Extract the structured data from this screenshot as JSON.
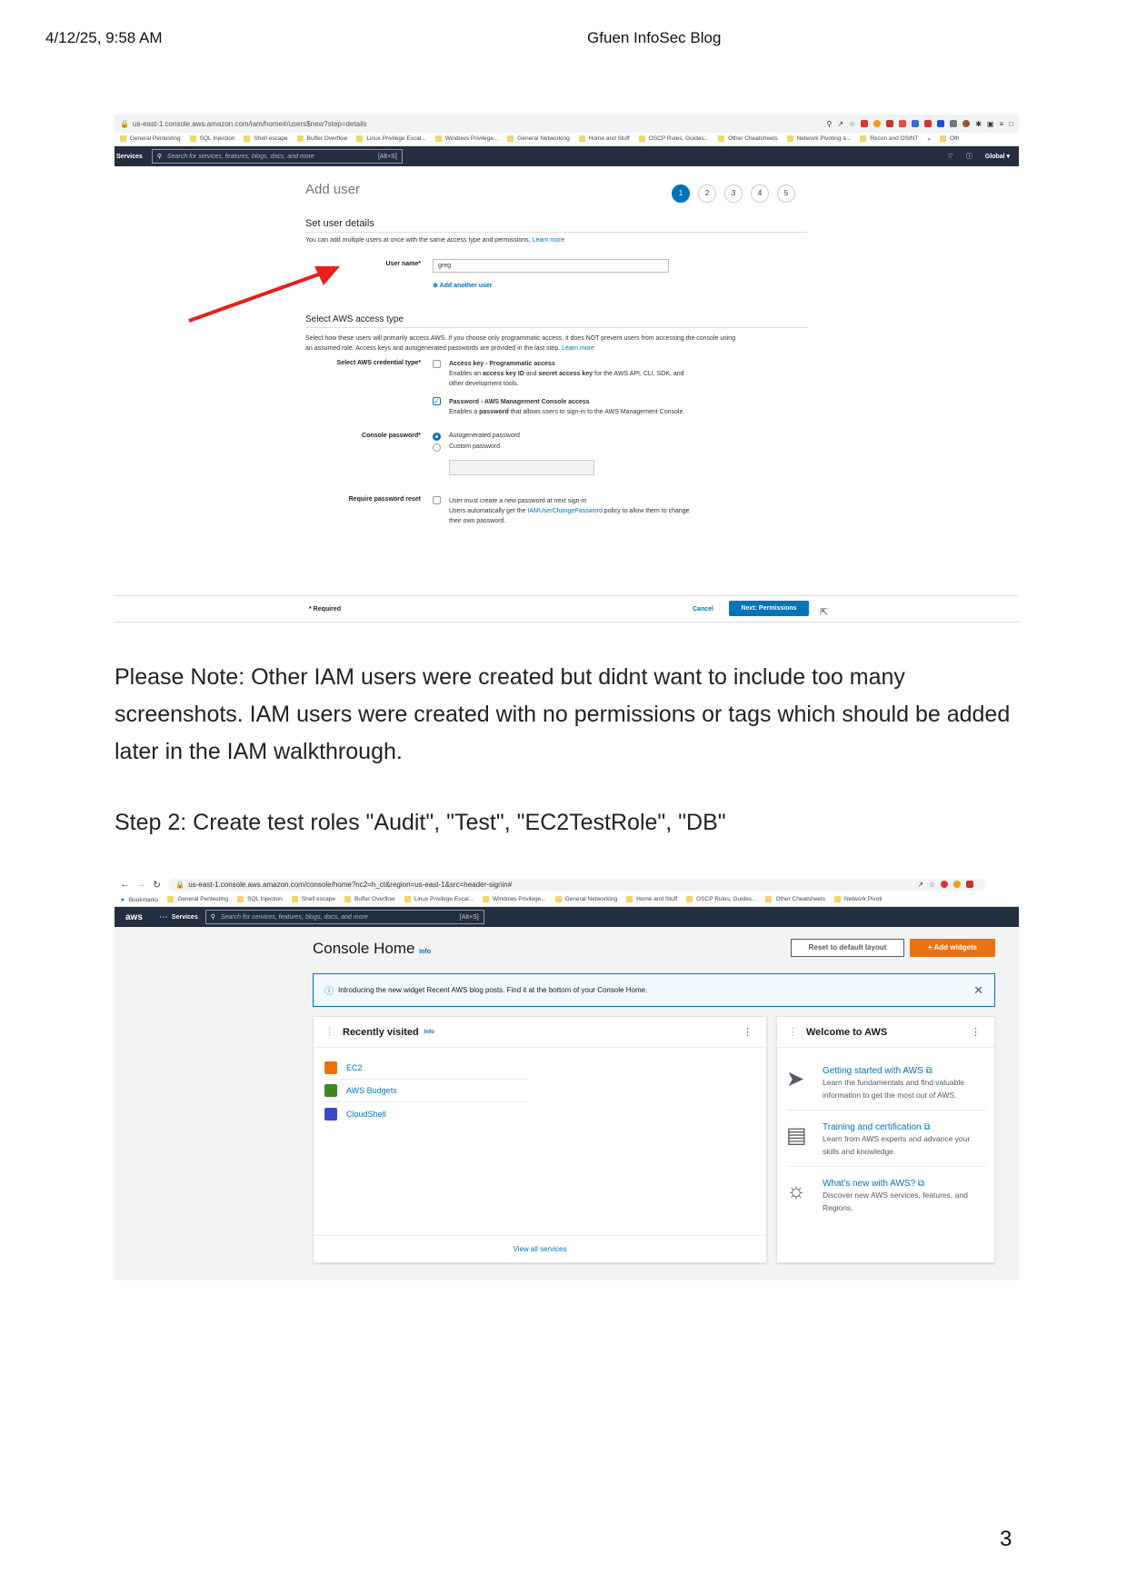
{
  "page_header": {
    "date": "4/12/25, 9:58 AM",
    "blog_title": "Gfuen InfoSec Blog"
  },
  "screenshot1": {
    "url": "us-east-1.console.aws.amazon.com/iam/home#/users$new?step=details",
    "bookmarks": [
      "General Pentesting",
      "SQL Injection",
      "Shell escape",
      "Buffer Overflow",
      "Linux Privilege Escal...",
      "Windows Privilege...",
      "General Networking",
      "Home and Stuff",
      "OSCP Rules, Guides...",
      "Other Cheatsheets",
      "Network Pivoting a...",
      "Recon and OSINT"
    ],
    "bookmarks_more": "»",
    "bookmarks_other": "Oth",
    "services": "Services",
    "search_placeholder": "Search for services, features, blogs, docs, and more",
    "search_shortcut": "[Alt+S]",
    "global": "Global ▾",
    "title": "Add user",
    "steps": [
      "1",
      "2",
      "3",
      "4",
      "5"
    ],
    "section1": "Set user details",
    "section1_desc": "You can add multiple users at once with the same access type and permissions.",
    "learn_more": "Learn more",
    "user_name_label": "User name*",
    "user_name_value": "greg",
    "add_another": "Add another user",
    "section2": "Select AWS access type",
    "section2_desc1": "Select how these users will primarily access AWS. If you choose only programmatic access, it does NOT prevent users from accessing the console using",
    "section2_desc2": "an assumed role. Access keys and autogenerated passwords are provided in the last step.",
    "cred_label": "Select AWS credential type*",
    "opt1_title": "Access key - Programmatic access",
    "opt1_desc1a": "Enables an ",
    "opt1_desc1b": "access key ID",
    "opt1_desc1c": " and ",
    "opt1_desc1d": "secret access key",
    "opt1_desc1e": " for the AWS API, CLI, SDK, and",
    "opt1_desc2": "other development tools.",
    "opt2_title": "Password - AWS Management Console access",
    "opt2_desc_a": "Enables a ",
    "opt2_desc_b": "password",
    "opt2_desc_c": " that allows users to sign-in to the AWS Management Console.",
    "console_pw_label": "Console password*",
    "pw_opt1": "Autogenerated password",
    "pw_opt2": "Custom password",
    "reset_label": "Require password reset",
    "reset_text1": "User must create a new password at next sign-in",
    "reset_text2a": "Users automatically get the ",
    "reset_text2b": "IAMUserChangePassword",
    "reset_text2c": " policy to allow them to change",
    "reset_text3": "their own password.",
    "required": "* Required",
    "cancel": "Cancel",
    "next": "Next: Permissions"
  },
  "note_paragraph": "Please Note: Other IAM users were created but didnt want to include too many screenshots. IAM users were created with no permissions or tags which should be added later in the IAM walkthrough.",
  "step2": "Step 2: Create test roles \"Audit\", \"Test\", \"EC2TestRole\", \"DB\"",
  "screenshot2": {
    "url": "us-east-1.console.aws.amazon.com/console/home?nc2=h_ct&region=us-east-1&src=header-signin#",
    "bookmarks": [
      "Bookmarks",
      "General Pentesting",
      "SQL Injection",
      "Shell escape",
      "Buffer Overflow",
      "Linux Privilege Escal...",
      "Windows Privilege...",
      "General Networking",
      "Home and Stuff",
      "OSCP Rules, Guides...",
      "Other Cheatsheets",
      "Network Pivoti"
    ],
    "aws_logo": "aws",
    "services": "Services",
    "search_placeholder": "Search for services, features, blogs, docs, and more",
    "search_shortcut": "[Alt+S]",
    "title": "Console Home",
    "info": "Info",
    "reset_layout": "Reset to default layout",
    "add_widgets": "Add widgets",
    "banner": "Introducing the new widget Recent AWS blog posts. Find it at the bottom of your Console Home.",
    "recent_title": "Recently visited",
    "recent_items": [
      "EC2",
      "AWS Budgets",
      "CloudShell"
    ],
    "view_all": "View all services",
    "welcome_title": "Welcome to AWS",
    "welcome_items": [
      {
        "title": "Getting started with AWS",
        "desc1": "Learn the fundamentals and find valuable",
        "desc2": "information to get the most out of AWS."
      },
      {
        "title": "Training and certification",
        "desc1": "Learn from AWS experts and advance your",
        "desc2": "skills and knowledge."
      },
      {
        "title": "What's new with AWS?",
        "desc1": "Discover new AWS services, features, and",
        "desc2": "Regions."
      }
    ]
  },
  "page_number": "3"
}
